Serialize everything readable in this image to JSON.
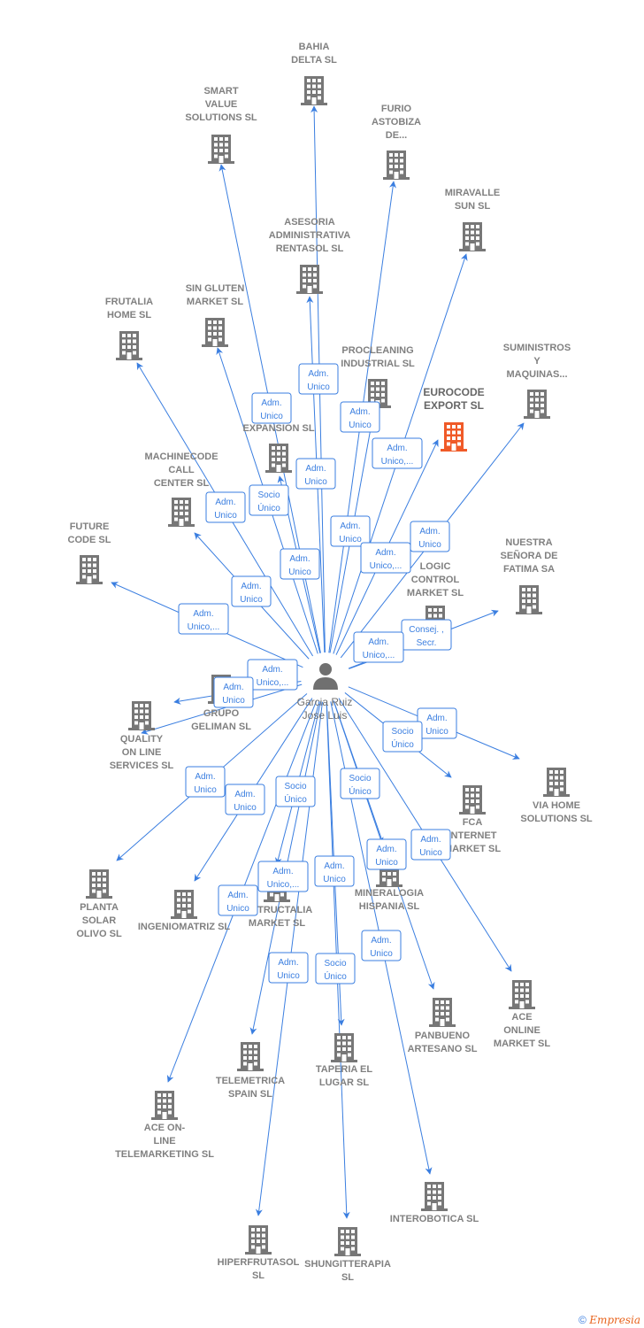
{
  "colors": {
    "edge": "#3a7ee0",
    "node": "#777777",
    "highlight": "#f05a28"
  },
  "center": {
    "name_lines": [
      "Garcia Ruiz",
      "Jose Luis"
    ],
    "icon": "person-icon"
  },
  "nodes": [
    {
      "lines": [
        "BAHIA",
        "DELTA SL"
      ]
    },
    {
      "lines": [
        "SMART",
        "VALUE",
        "SOLUTIONS SL"
      ]
    },
    {
      "lines": [
        "FURIO",
        "ASTOBIZA",
        "DE..."
      ]
    },
    {
      "lines": [
        "MIRAVALLE",
        "SUN  SL"
      ]
    },
    {
      "lines": [
        "ASESORIA",
        "ADMINISTRATIVA",
        "RENTASOL SL"
      ]
    },
    {
      "lines": [
        "SIN GLUTEN",
        "MARKET  SL"
      ]
    },
    {
      "lines": [
        "FRUTALIA",
        "HOME  SL"
      ]
    },
    {
      "lines": [
        "PROCLEANING",
        "INDUSTRIAL SL"
      ]
    },
    {
      "lines": [
        "EUROCODE",
        "EXPORT  SL"
      ],
      "highlight": true
    },
    {
      "lines": [
        "SUMINISTROS",
        "Y",
        "MAQUINAS..."
      ]
    },
    {
      "lines": [
        "BY",
        "ES",
        "EXPANSION SL"
      ]
    },
    {
      "lines": [
        "MACHINECODE",
        "CALL",
        "CENTER  SL"
      ]
    },
    {
      "lines": [
        "FUTURE",
        "CODE  SL"
      ]
    },
    {
      "lines": [
        "NUESTRA",
        "SEÑORA DE",
        "FATIMA SA"
      ]
    },
    {
      "lines": [
        "LOGIC",
        "CONTROL",
        "MARKET  SL"
      ]
    },
    {
      "lines": [
        "GRUPO",
        "GELIMAN  SL"
      ]
    },
    {
      "lines": [
        "QUALITY",
        "ON LINE",
        "SERVICES  SL"
      ]
    },
    {
      "lines": [
        "VIA HOME",
        "SOLUTIONS SL"
      ]
    },
    {
      "lines": [
        "FCA",
        "INTERNET",
        "MARKET  SL"
      ]
    },
    {
      "lines": [
        "PLANTA",
        "SOLAR",
        "OLIVO SL"
      ]
    },
    {
      "lines": [
        "INGENIOMATRIZ SL"
      ]
    },
    {
      "lines": [
        "INSTRUCTALIA",
        "MARKET  SL"
      ]
    },
    {
      "lines": [
        "MINERALOGIA",
        "HISPANIA  SL"
      ]
    },
    {
      "lines": [
        "PANBUENO",
        "ARTESANO  SL"
      ]
    },
    {
      "lines": [
        "ACE",
        "ONLINE",
        "MARKET SL"
      ]
    },
    {
      "lines": [
        "TELEMETRICA",
        "SPAIN  SL"
      ]
    },
    {
      "lines": [
        "TAPERIA EL",
        "LUGAR SL"
      ]
    },
    {
      "lines": [
        "ACE ON-",
        "LINE",
        "TELEMARKETING SL"
      ]
    },
    {
      "lines": [
        "INTEROBOTICA SL"
      ]
    },
    {
      "lines": [
        "HIPERFRUTASOL",
        "SL"
      ]
    },
    {
      "lines": [
        "SHUNGITTERAPIA",
        "SL"
      ]
    }
  ],
  "edge_labels": [
    [
      "Adm.",
      "Unico"
    ],
    [
      "Adm.",
      "Unico"
    ],
    [
      "Adm.",
      "Unico"
    ],
    [
      "Adm.",
      "Unico,..."
    ],
    [
      "Adm.",
      "Unico"
    ],
    [
      "Socio",
      "Único"
    ],
    [
      "Adm.",
      "Unico"
    ],
    [
      "Adm.",
      "Unico"
    ],
    [
      "Adm.",
      "Unico"
    ],
    [
      "Adm.",
      "Unico,..."
    ],
    [
      "Adm.",
      "Unico"
    ],
    [
      "Adm.",
      "Unico"
    ],
    [
      "Adm.",
      "Unico,..."
    ],
    [
      "Consej. ,",
      "Secr."
    ],
    [
      "Adm.",
      "Unico,..."
    ],
    [
      "Adm.",
      "Unico,..."
    ],
    [
      "Adm.",
      "Unico"
    ],
    [
      "Adm.",
      "Unico"
    ],
    [
      "Socio",
      "Único"
    ],
    [
      "Adm.",
      "Unico"
    ],
    [
      "Adm.",
      "Unico"
    ],
    [
      "Socio",
      "Único"
    ],
    [
      "Socio",
      "Único"
    ],
    [
      "Adm.",
      "Unico"
    ],
    [
      "Adm.",
      "Unico"
    ],
    [
      "Adm.",
      "Unico"
    ],
    [
      "Adm.",
      "Unico,..."
    ],
    [
      "Adm.",
      "Unico"
    ],
    [
      "Adm.",
      "Unico"
    ],
    [
      "Socio",
      "Único"
    ],
    [
      "Adm.",
      "Unico"
    ]
  ],
  "footer": {
    "copyright": "©",
    "brand": "Empresia"
  }
}
